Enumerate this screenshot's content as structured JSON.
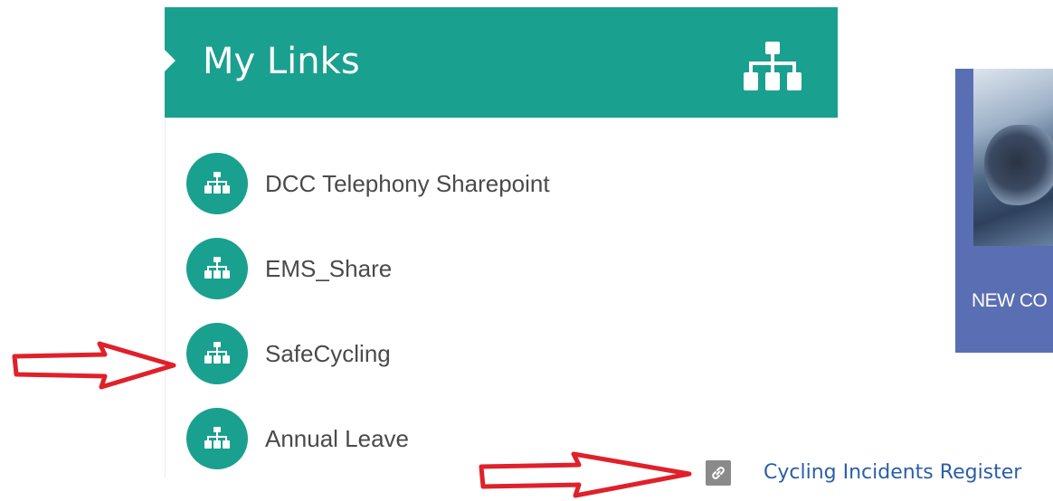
{
  "panel": {
    "title": "My Links",
    "header_icon": "sitemap-icon",
    "accent_color": "#1aa08f",
    "links": [
      {
        "label": "DCC Telephony Sharepoint",
        "icon": "sitemap-icon"
      },
      {
        "label": "EMS_Share",
        "icon": "sitemap-icon"
      },
      {
        "label": "SafeCycling",
        "icon": "sitemap-icon"
      },
      {
        "label": "Annual Leave",
        "icon": "sitemap-icon"
      }
    ]
  },
  "promo": {
    "label": "NEW CO",
    "background_color": "#5a6fb3"
  },
  "register_link": {
    "label": "Cycling Incidents Register",
    "icon": "chain-link-icon",
    "color": "#2b5ea8"
  },
  "annotations": {
    "arrow_color": "#e0202a",
    "arrows": [
      "left-pointing-to-safecycling",
      "bottom-pointing-to-register-link"
    ]
  }
}
